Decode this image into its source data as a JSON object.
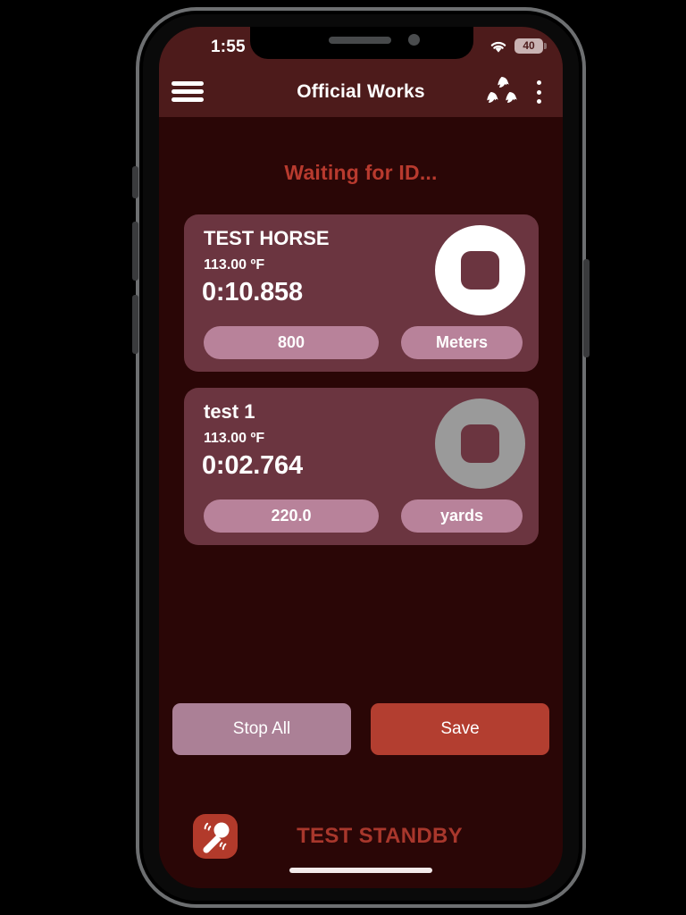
{
  "status_bar": {
    "time": "1:55",
    "wifi_icon": "wifi-icon",
    "battery_level": "40"
  },
  "app_bar": {
    "menu_icon": "hamburger-menu-icon",
    "title": "Official Works",
    "logo_icon": "horse-heads-logo-icon",
    "overflow_icon": "kebab-menu-icon"
  },
  "main": {
    "waiting_message": "Waiting for ID...",
    "cards": [
      {
        "name": "TEST HORSE",
        "temperature": "113.00 ºF",
        "time": "0:10.858",
        "stop_icon": "stop-square-icon",
        "stop_state": "active",
        "distance": "800",
        "unit": "Meters"
      },
      {
        "name": "test 1",
        "temperature": "113.00 ºF",
        "time": "0:02.764",
        "stop_icon": "stop-square-icon",
        "stop_state": "inactive",
        "distance": "220.0",
        "unit": "yards"
      }
    ]
  },
  "actions": {
    "stop_all_label": "Stop All",
    "save_label": "Save"
  },
  "bottom": {
    "reader_icon": "rfid-wand-reader-icon",
    "status_text": "TEST STANDBY"
  },
  "colors": {
    "background": "#2a0606",
    "app_bar": "#4d1b1b",
    "card": "#6b3540",
    "pill": "#b8829a",
    "accent_red": "#b83a2e",
    "save_button": "#b33e30",
    "stop_all_button": "#ab8096",
    "status_text": "#a8372c"
  }
}
